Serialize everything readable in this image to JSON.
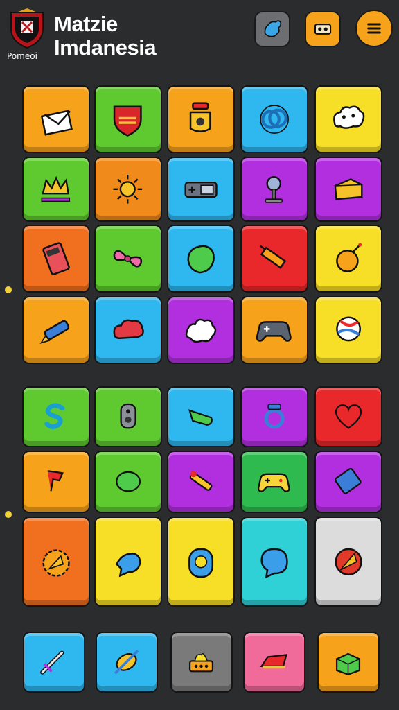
{
  "header": {
    "title_line1": "Matzie",
    "title_line2": "Imdanesia",
    "logo_caption": "Pomeoi"
  },
  "colors": {
    "background": "#2b2c2e",
    "orange": "#f6a21a",
    "green": "#5fca2f",
    "blue": "#2fb7ef",
    "yellow": "#f7de27",
    "purple": "#b22fe0",
    "red": "#e8282a",
    "teal": "#2fd0d6",
    "gray": "#dcdcdc",
    "pink": "#f06a9a"
  },
  "tiles": [
    {
      "name": "envelope-icon",
      "color": "#f6a21a"
    },
    {
      "name": "shield-icon",
      "color": "#5fca2f"
    },
    {
      "name": "bell-icon",
      "color": "#f6a21a"
    },
    {
      "name": "knot-icon",
      "color": "#2fb7ef"
    },
    {
      "name": "cloud-faces-icon",
      "color": "#f7de27"
    },
    {
      "name": "crown-icon",
      "color": "#5fca2f"
    },
    {
      "name": "sun-icon",
      "color": "#f08a1a"
    },
    {
      "name": "gamepad-icon",
      "color": "#2fb7ef"
    },
    {
      "name": "joystick-icon",
      "color": "#b22fe0"
    },
    {
      "name": "cheese-icon",
      "color": "#b22fe0"
    },
    {
      "name": "calculator-icon",
      "color": "#f07020"
    },
    {
      "name": "bow-icon",
      "color": "#5fca2f"
    },
    {
      "name": "leaf-icon",
      "color": "#2fb7ef"
    },
    {
      "name": "pencil-icon",
      "color": "#e8282a"
    },
    {
      "name": "bomb-icon",
      "color": "#f7de27"
    },
    {
      "name": "rocket-icon",
      "color": "#f6a21a"
    },
    {
      "name": "cloud-icon",
      "color": "#2fb7ef"
    },
    {
      "name": "splash-icon",
      "color": "#b22fe0"
    },
    {
      "name": "controller-icon",
      "color": "#f6a21a"
    },
    {
      "name": "ball-icon",
      "color": "#f7de27"
    },
    {
      "name": "letter-s-icon",
      "color": "#5fca2f"
    },
    {
      "name": "gamepad-vertical-icon",
      "color": "#5fca2f"
    },
    {
      "name": "horn-icon",
      "color": "#2fb7ef"
    },
    {
      "name": "ring-icon",
      "color": "#b22fe0"
    },
    {
      "name": "heart-icon",
      "color": "#e8282a"
    },
    {
      "name": "flag-icon",
      "color": "#f6a21a"
    },
    {
      "name": "lemon-icon",
      "color": "#5fca2f"
    },
    {
      "name": "brush-icon",
      "color": "#b22fe0"
    },
    {
      "name": "yellow-controller-icon",
      "color": "#2fba4f"
    },
    {
      "name": "card-icon",
      "color": "#b22fe0"
    },
    {
      "name": "badge-icon",
      "color": "#f07020"
    },
    {
      "name": "fish-icon",
      "color": "#f7de27"
    },
    {
      "name": "donut-icon",
      "color": "#f7de27"
    },
    {
      "name": "speech-bubble-icon",
      "color": "#2fd0d6"
    },
    {
      "name": "pizza-icon",
      "color": "#dcdcdc"
    },
    {
      "name": "sword-icon",
      "color": "#2fb7ef"
    },
    {
      "name": "compass-icon",
      "color": "#2fb7ef"
    },
    {
      "name": "fire-box-icon",
      "color": "#7a7a7a"
    },
    {
      "name": "boat-icon",
      "color": "#f06a9a"
    },
    {
      "name": "gift-box-icon",
      "color": "#f6a21a"
    }
  ]
}
